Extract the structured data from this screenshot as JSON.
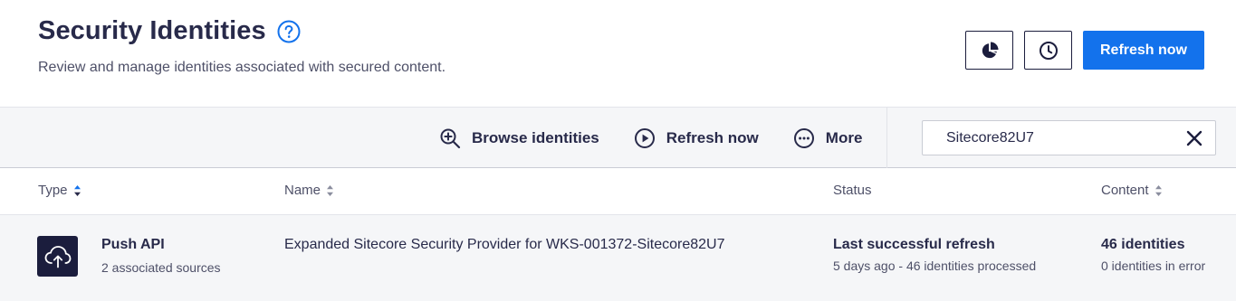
{
  "header": {
    "title": "Security Identities",
    "subtitle": "Review and manage identities associated with secured content.",
    "help_icon": "question-circle-icon",
    "buttons": {
      "usage_icon": "pie-chart-icon",
      "history_icon": "clock-icon",
      "refresh_label": "Refresh now"
    }
  },
  "toolbar": {
    "actions": [
      {
        "icon": "zoom-in-icon",
        "label": "Browse identities"
      },
      {
        "icon": "play-circle-icon",
        "label": "Refresh now"
      },
      {
        "icon": "more-circle-icon",
        "label": "More"
      }
    ],
    "search": {
      "value": "Sitecore82U7",
      "clear_icon": "close-icon"
    }
  },
  "table": {
    "columns": [
      {
        "label": "Type",
        "sortable": true,
        "sort_active": true
      },
      {
        "label": "Name",
        "sortable": true,
        "sort_active": false
      },
      {
        "label": "Status",
        "sortable": false,
        "sort_active": false
      },
      {
        "label": "Content",
        "sortable": true,
        "sort_active": false
      }
    ],
    "rows": [
      {
        "type_icon": "cloud-upload-icon",
        "type": "Push API",
        "sources": "2 associated sources",
        "name": "Expanded Sitecore Security Provider for WKS-001372-Sitecore82U7",
        "status": "Last successful refresh",
        "status_detail": "5 days ago - 46 identities processed",
        "content": "46 identities",
        "content_detail": "0 identities in error"
      }
    ]
  },
  "colors": {
    "primary": "#1372ec",
    "text_dark": "#282a4a",
    "icon_dark": "#1b1d3d",
    "toolbar_bg": "#f5f6f8"
  }
}
